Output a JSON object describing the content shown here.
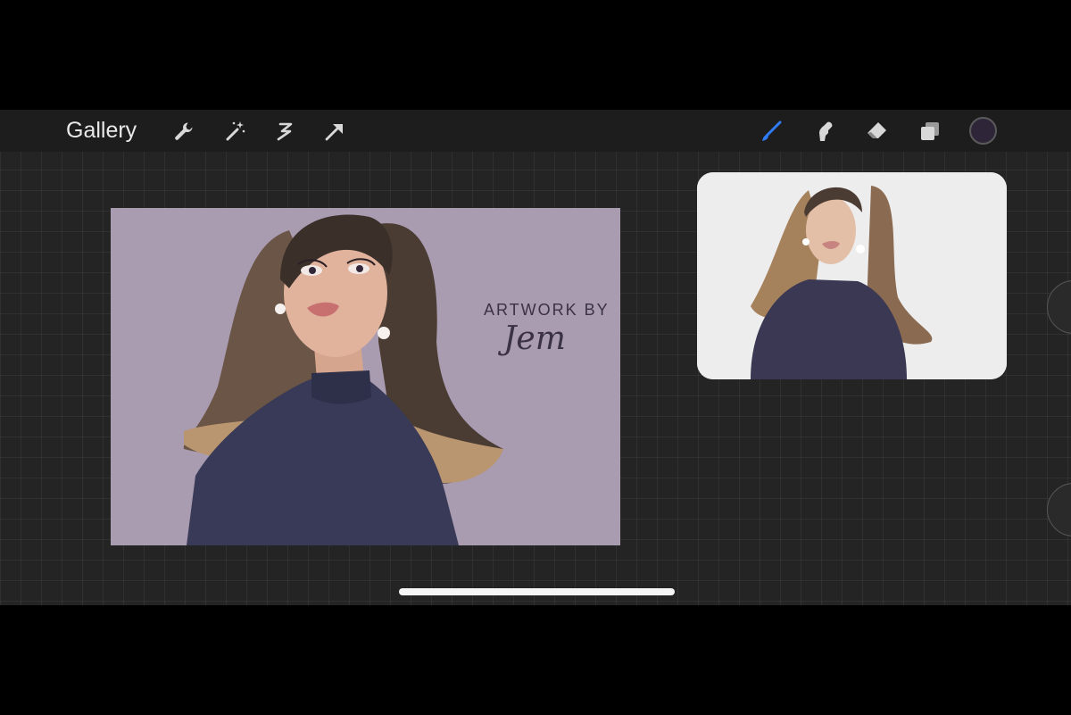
{
  "toolbar": {
    "gallery_label": "Gallery",
    "left_tools": [
      "wrench-icon",
      "magic-wand-icon",
      "selection-icon",
      "transform-arrow-icon"
    ],
    "right_tools": [
      "brush-icon",
      "smudge-icon",
      "eraser-icon",
      "layers-icon"
    ],
    "active_tool": "brush-icon",
    "active_tool_color": "#2f7cf6",
    "current_color": "#2e2638"
  },
  "canvas": {
    "signature_line1": "ARTWORK BY",
    "signature_line2": "Jem",
    "background_color": "#a99bb0"
  },
  "reference_panel": {
    "background_color": "#ededee"
  }
}
